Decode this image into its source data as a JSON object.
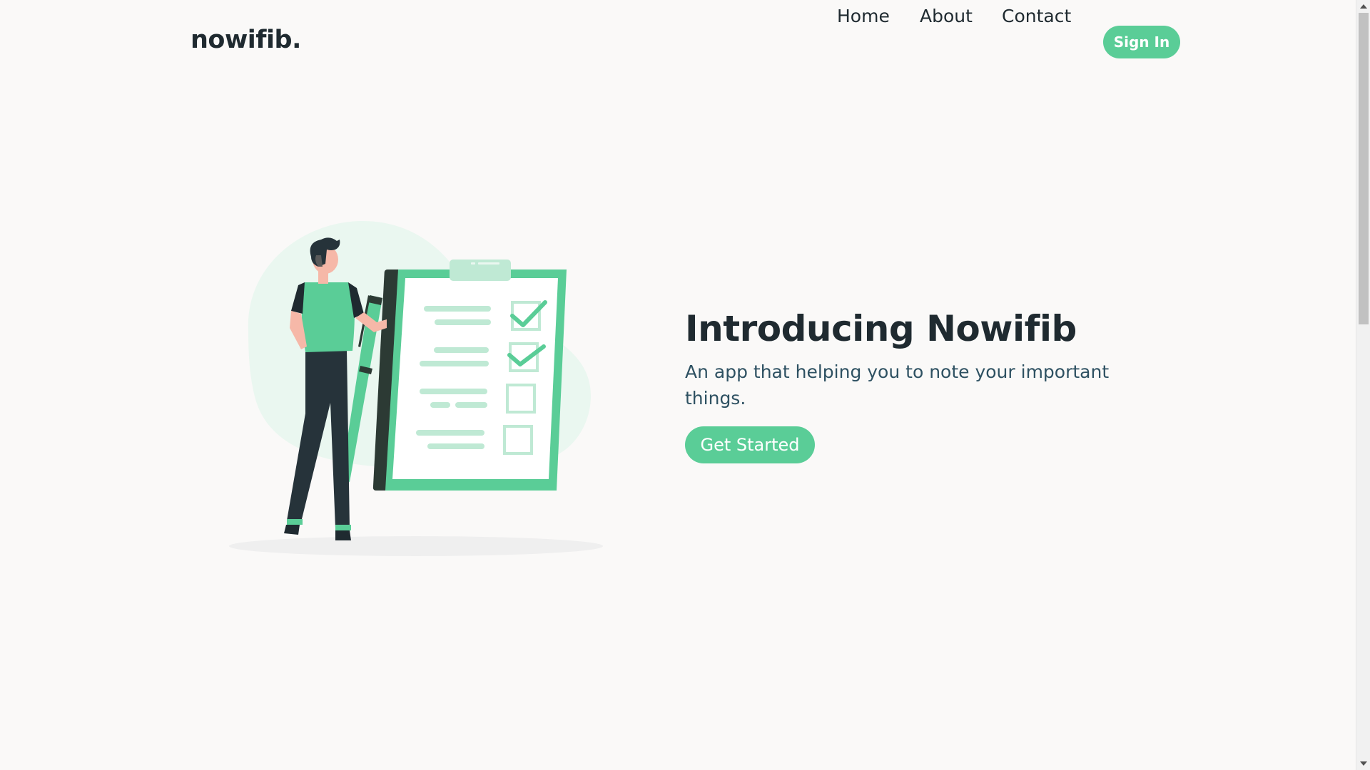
{
  "header": {
    "logo": "nowifib.",
    "nav": [
      "Home",
      "About",
      "Contact"
    ],
    "sign_in": "Sign In"
  },
  "hero": {
    "title": "Introducing Nowifib",
    "subtitle": "An app that helping you to note your important things.",
    "cta": "Get Started",
    "illustration": "person-with-checklist-clipboard-illustration"
  },
  "colors": {
    "background": "#faf9f8",
    "accent": "#5acd97",
    "accent_light": "#bfe9d4",
    "text_dark": "#1f2a30",
    "text_sub": "#2e5162"
  },
  "icons": {
    "checklist": "clipboard-checklist-icon",
    "checkmark": "checkmark-icon"
  }
}
